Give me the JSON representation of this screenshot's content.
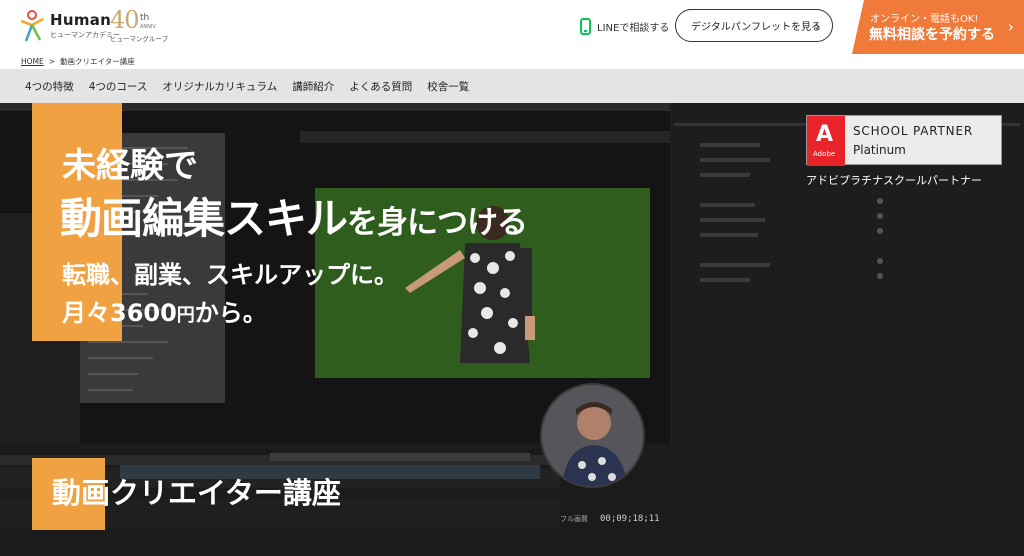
{
  "header": {
    "logo": {
      "name": "Human",
      "subtitle": "ヒューマンアカデミー"
    },
    "anniversary": {
      "number": "40",
      "suffix": "th",
      "small": "ANNIV.",
      "group": "ヒューマングループ"
    },
    "line_label": "LINEで相談する",
    "pamphlet_label": "デジタルパンフレットを見る",
    "consult": {
      "small": "オンライン・電話もOK!",
      "big": "無料相談を予約する"
    }
  },
  "breadcrumb": {
    "home": "HOME",
    "separator": ">",
    "current": "動画クリエイター講座"
  },
  "nav": {
    "items": [
      "4つの特徴",
      "4つのコース",
      "オリジナルカリキュラム",
      "講師紹介",
      "よくある質問",
      "校舎一覧"
    ]
  },
  "hero": {
    "line1": "未経験で",
    "line2_main": "動画編集スキル",
    "line2_tail": "を身につける",
    "line3": "転職、副業、スキルアップに。",
    "line4_a": "月々",
    "line4_num": "3600",
    "line4_yen": "円",
    "line4_b": "から。",
    "partner": {
      "adobe_letter": "A",
      "adobe_word": "Adobe",
      "l1": "SCHOOL PARTNER",
      "l2": "Platinum",
      "caption": "アドビプラチナスクールパートナー"
    },
    "course_title": "動画クリエイター講座",
    "timecode": "00;09;18;11",
    "fit_label": "フル画質"
  },
  "colors": {
    "orange": "#ef7a3a",
    "hero_orange": "#f0a243",
    "line_green": "#06c755",
    "adobe_red": "#e8232a"
  }
}
